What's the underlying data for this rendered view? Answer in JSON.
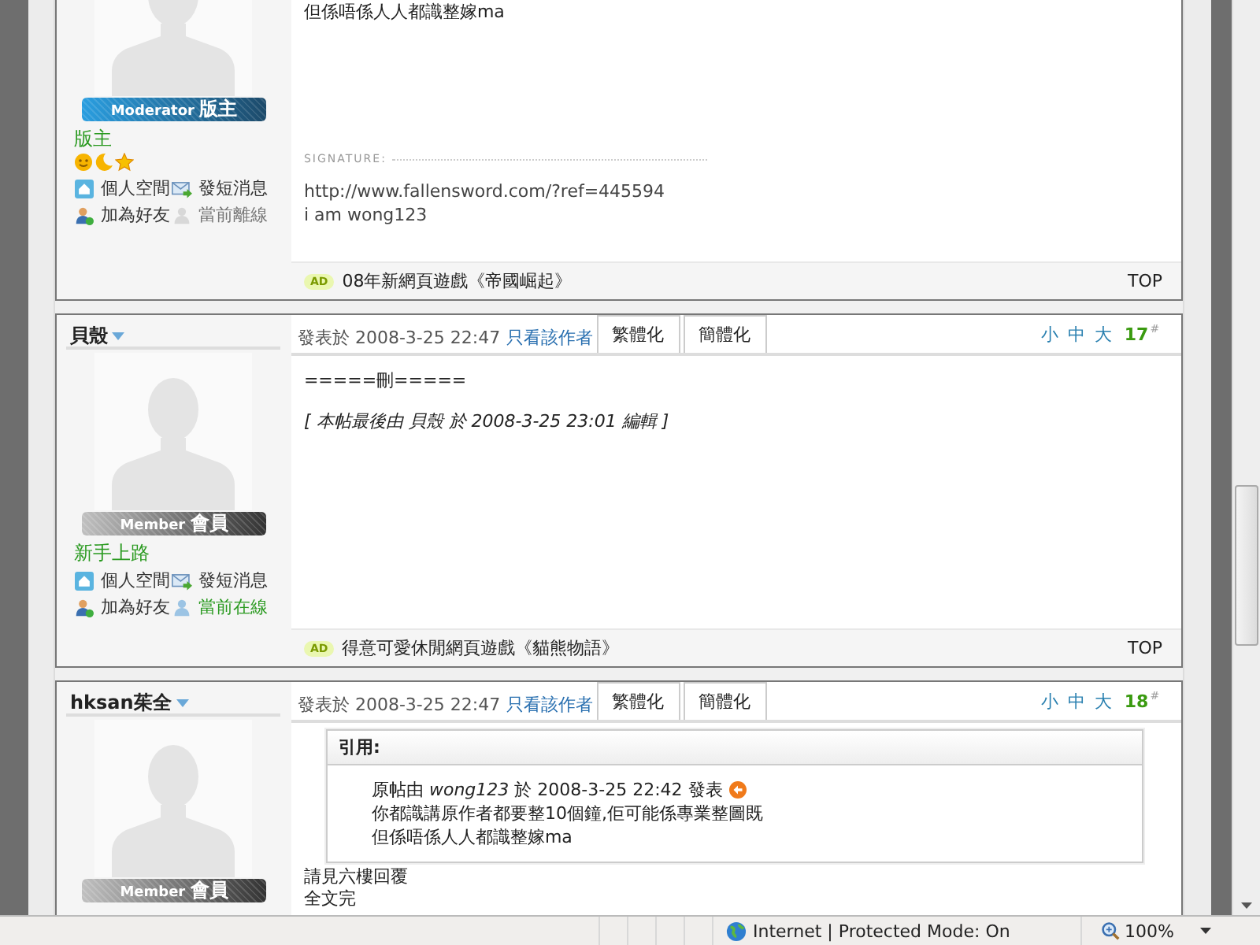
{
  "posts": [
    {
      "badge": {
        "kind": "moderator",
        "role": "Moderator",
        "title": "版主"
      },
      "rank": "版主",
      "level_icons": [
        {
          "kind": "sun"
        },
        {
          "kind": "moon"
        },
        {
          "kind": "star"
        }
      ],
      "profile_links": [
        {
          "kind": "home",
          "label": "個人空間"
        },
        {
          "kind": "message",
          "label": "發短消息"
        },
        {
          "kind": "add-friend",
          "label": "加為好友"
        },
        {
          "kind": "status",
          "label": "當前離線",
          "online": false
        }
      ],
      "body": [
        {
          "kind": "text",
          "text": "但係唔係人人都識整嫁ma"
        },
        {
          "kind": "signature",
          "label": "SIGNATURE:",
          "lines": [
            "http://www.fallensword.com/?ref=445594",
            "i am wong123"
          ]
        }
      ],
      "footer": {
        "ad": "AD",
        "text": "08年新網頁遊戲《帝國崛起》",
        "top": "TOP"
      }
    },
    {
      "author": "貝殼",
      "posted": "發表於 2008-3-25 22:47",
      "author_only": "只看該作者",
      "tabs": [
        "繁體化",
        "簡體化"
      ],
      "font_sizes": [
        "小",
        "中",
        "大"
      ],
      "floor": "17",
      "floor_mark": "#",
      "badge": {
        "kind": "member",
        "role": "Member",
        "title": "會員"
      },
      "rank": "新手上路",
      "profile_links": [
        {
          "kind": "home",
          "label": "個人空間"
        },
        {
          "kind": "message",
          "label": "發短消息"
        },
        {
          "kind": "add-friend",
          "label": "加為好友"
        },
        {
          "kind": "status",
          "label": "當前在線",
          "online": true
        }
      ],
      "body": [
        {
          "kind": "text",
          "text": "=====刪====="
        },
        {
          "kind": "edit_note",
          "text": "[ 本帖最後由 貝殼 於 2008-3-25 23:01 編輯 ]"
        }
      ],
      "footer": {
        "ad": "AD",
        "text": "得意可愛休閒網頁遊戲《貓熊物語》",
        "top": "TOP"
      }
    },
    {
      "author": "hksan茱全",
      "posted": "發表於 2008-3-25 22:47",
      "author_only": "只看該作者",
      "tabs": [
        "繁體化",
        "簡體化"
      ],
      "font_sizes": [
        "小",
        "中",
        "大"
      ],
      "floor": "18",
      "floor_mark": "#",
      "badge": {
        "kind": "member",
        "role": "Member",
        "title": "會員"
      },
      "body": [
        {
          "kind": "quote",
          "title": "引用:",
          "byline": "原帖由 *wong123* 於 2008-3-25 22:42 發表",
          "lines": [
            "你都識講原作者都要整10個鐘,佢可能係專業整圖既",
            "但係唔係人人都識整嫁ma"
          ]
        },
        {
          "kind": "text",
          "text": "請見六樓回覆"
        },
        {
          "kind": "text",
          "text": "全文完"
        }
      ]
    }
  ],
  "status_bar": {
    "zone": "Internet | Protected Mode: On",
    "zoom": "100%"
  }
}
